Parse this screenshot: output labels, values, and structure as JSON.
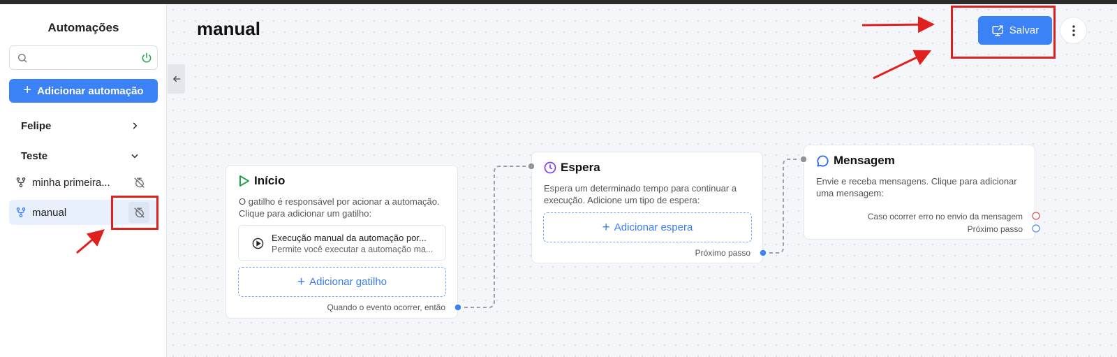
{
  "sidebar": {
    "title": "Automações",
    "search_placeholder": "",
    "add_button": "Adicionar automação",
    "groups": [
      {
        "label": "Felipe",
        "expanded": false
      },
      {
        "label": "Teste",
        "expanded": true
      }
    ],
    "items": [
      {
        "label": "minha primeira...",
        "active": false
      },
      {
        "label": "manual",
        "active": true
      }
    ]
  },
  "header": {
    "title": "manual",
    "save_button": "Salvar"
  },
  "nodes": {
    "inicio": {
      "title": "Início",
      "description": "O gatilho é responsável por acionar a automação. Clique para adicionar um gatilho:",
      "trigger_title": "Execução manual da automação por...",
      "trigger_subtitle": "Permite você executar a automação ma...",
      "add_button": "Adicionar gatilho",
      "output_label": "Quando o evento ocorrer, então"
    },
    "espera": {
      "title": "Espera",
      "description": "Espera um determinado tempo para continuar a execução. Adicione um tipo de espera:",
      "add_button": "Adicionar espera",
      "output_label": "Próximo passo"
    },
    "mensagem": {
      "title": "Mensagem",
      "description": "Envie e receba mensagens. Clique para adicionar uma mensagem:",
      "error_label": "Caso ocorrer erro no envio da mensagem",
      "output_label": "Próximo passo"
    }
  },
  "colors": {
    "accent": "#3b82f6",
    "annotation_red": "#e01f1f",
    "start_green": "#22a34a",
    "wait_purple": "#7c3aed",
    "message_blue": "#2563eb"
  },
  "icons": [
    "search-icon",
    "power-icon",
    "plus-icon",
    "chevron-right-icon",
    "chevron-down-icon",
    "flow-icon",
    "timer-off-icon",
    "arrow-left-icon",
    "play-icon",
    "play-circle-icon",
    "clock-icon",
    "chat-bubble-icon",
    "external-screen-icon",
    "more-vertical-icon"
  ]
}
